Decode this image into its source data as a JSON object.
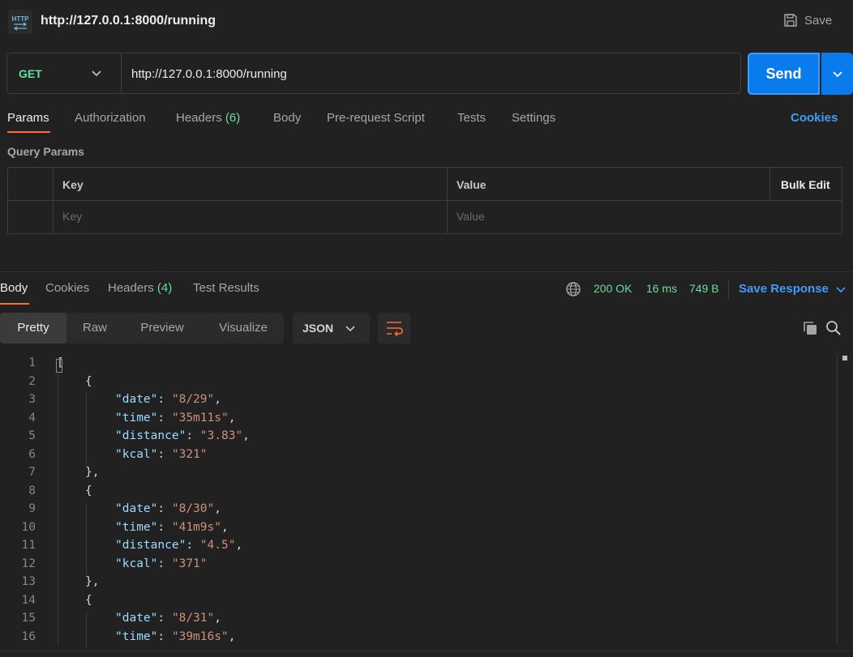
{
  "request": {
    "title": "http://127.0.0.1:8000/running",
    "save_label": "Save",
    "method": "GET",
    "url": "http://127.0.0.1:8000/running",
    "send_label": "Send"
  },
  "request_tabs": {
    "params": "Params",
    "authorization": "Authorization",
    "headers": "Headers",
    "headers_count": "(6)",
    "body": "Body",
    "prerequest": "Pre-request Script",
    "tests": "Tests",
    "settings": "Settings",
    "cookies": "Cookies"
  },
  "query_params": {
    "title": "Query Params",
    "key_header": "Key",
    "value_header": "Value",
    "bulk_edit": "Bulk Edit",
    "key_placeholder": "Key",
    "value_placeholder": "Value"
  },
  "response_tabs": {
    "body": "Body",
    "cookies": "Cookies",
    "headers": "Headers",
    "headers_count": "(4)",
    "test_results": "Test Results"
  },
  "response_meta": {
    "status": "200 OK",
    "time": "16 ms",
    "size": "749 B",
    "save_response": "Save Response"
  },
  "view": {
    "pretty": "Pretty",
    "raw": "Raw",
    "preview": "Preview",
    "visualize": "Visualize",
    "format": "JSON"
  },
  "colors": {
    "accent": "#ff6c37",
    "send": "#097bed",
    "status_green": "#6bdd9a",
    "link_blue": "#3f9cf8"
  },
  "code": {
    "line_numbers": [
      "1",
      "2",
      "3",
      "4",
      "5",
      "6",
      "7",
      "8",
      "9",
      "10",
      "11",
      "12",
      "13",
      "14",
      "15",
      "16"
    ],
    "lines": [
      {
        "open": "["
      },
      {
        "open": "{"
      },
      {
        "key": "\"date\"",
        "sep": ": ",
        "val": "\"8/29\"",
        "end": ","
      },
      {
        "key": "\"time\"",
        "sep": ": ",
        "val": "\"35m11s\"",
        "end": ","
      },
      {
        "key": "\"distance\"",
        "sep": ": ",
        "val": "\"3.83\"",
        "end": ","
      },
      {
        "key": "\"kcal\"",
        "sep": ": ",
        "val": "\"321\"",
        "end": ""
      },
      {
        "close": "},"
      },
      {
        "open": "{"
      },
      {
        "key": "\"date\"",
        "sep": ": ",
        "val": "\"8/30\"",
        "end": ","
      },
      {
        "key": "\"time\"",
        "sep": ": ",
        "val": "\"41m9s\"",
        "end": ","
      },
      {
        "key": "\"distance\"",
        "sep": ": ",
        "val": "\"4.5\"",
        "end": ","
      },
      {
        "key": "\"kcal\"",
        "sep": ": ",
        "val": "\"371\"",
        "end": ""
      },
      {
        "close": "},"
      },
      {
        "open": "{"
      },
      {
        "key": "\"date\"",
        "sep": ": ",
        "val": "\"8/31\"",
        "end": ","
      },
      {
        "key": "\"time\"",
        "sep": ": ",
        "val": "\"39m16s\"",
        "end": ","
      }
    ]
  }
}
